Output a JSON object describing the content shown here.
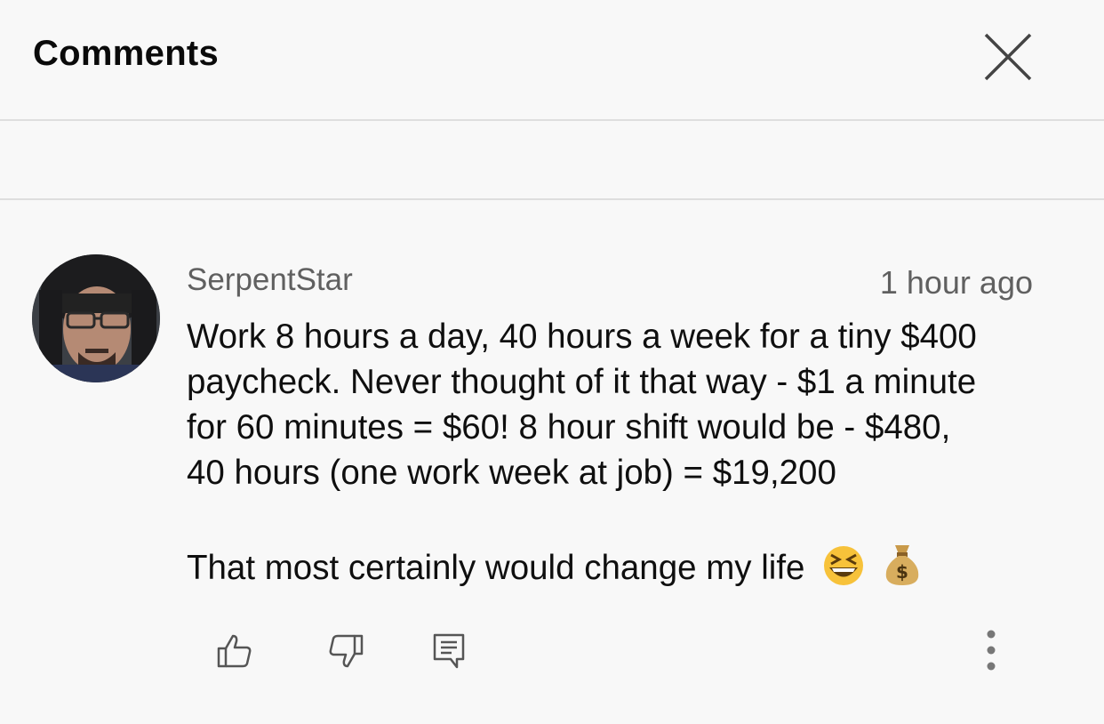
{
  "header": {
    "title": "Comments",
    "close_icon": "close-icon"
  },
  "comment": {
    "author": "SerpentStar",
    "timestamp": "1 hour ago",
    "text": "Work 8 hours a day, 40 hours a week for a tiny $400\npaycheck. Never thought of it that way - $1 a minute\nfor 60 minutes = $60! 8 hour shift would be - $480,\n40 hours (one work week at job) = $19,200",
    "text2": "That most certainly would change my life",
    "emojis": [
      "grinning-squinting-face-emoji",
      "money-bag-emoji"
    ],
    "actions": {
      "like_icon": "thumbs-up-icon",
      "dislike_icon": "thumbs-down-icon",
      "reply_icon": "reply-icon",
      "more_icon": "more-vertical-icon"
    }
  },
  "colors": {
    "background": "#f8f8f8",
    "divider": "#dedede",
    "primary_text": "#0f0f0f",
    "secondary_text": "#606060"
  }
}
